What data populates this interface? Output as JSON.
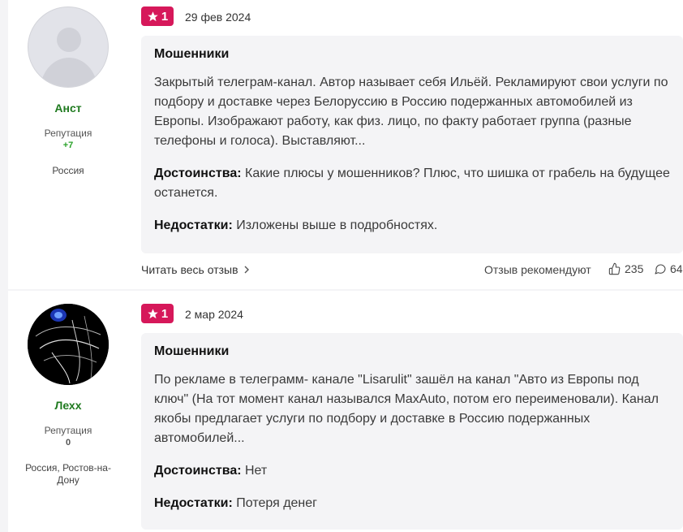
{
  "reviews": [
    {
      "author": {
        "name": "Анст",
        "rep_label": "Репутация",
        "rep_value": "+7",
        "rep_color": "#2aa22a",
        "location": "Россия"
      },
      "rating": "1",
      "date": "29 фев 2024",
      "title": "Мошенники",
      "text": "Закрытый телеграм-канал. Автор называет себя Ильёй. Рекламируют свои услуги по подбору и доставке через Белоруссию в Россию подержанных автомобилей из Европы. Изображают работу, как физ. лицо, по факту работает группа (разные телефоны и голоса). Выставляют...",
      "pros_label": "Достоинства:",
      "pros": "Какие плюсы у мошенников? Плюс, что шишка от грабель на будущее останется.",
      "cons_label": "Недостатки:",
      "cons": "Изложены выше в подробностях.",
      "read_more": "Читать весь отзыв",
      "recommend_label": "Отзыв рекомендуют",
      "likes": "235",
      "comments": "64"
    },
    {
      "author": {
        "name": "Лехх",
        "rep_label": "Репутация",
        "rep_value": "0",
        "rep_color": "#555555",
        "location": "Россия, Ростов-на-Дону"
      },
      "rating": "1",
      "date": "2 мар 2024",
      "title": "Мошенники",
      "text": "По рекламе в телеграмм- канале \"Lisarulit\" зашёл на канал \"Авто из Европы под ключ\" (На тот момент канал назывался MaxAuto, потом его переименовали). Канал якобы предлагает услуги по подбору и доставке в Россию подержанных автомобилей...",
      "pros_label": "Достоинства:",
      "pros": "Нет",
      "cons_label": "Недостатки:",
      "cons": "Потеря денег"
    }
  ],
  "colors": {
    "badge": "#d6185a",
    "author_name": "#1f7a1f",
    "body_bg": "#f4f4f6"
  },
  "icons": {
    "rating": "star-icon",
    "likes": "thumbs-up-icon",
    "comments": "comment-icon",
    "read_more": "chevron-right-icon"
  }
}
